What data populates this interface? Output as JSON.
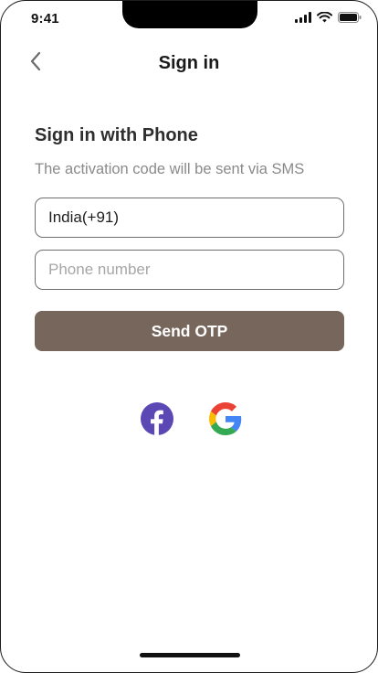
{
  "status_bar": {
    "time": "9:41",
    "icons": [
      "cellular-signal-icon",
      "wifi-icon",
      "battery-icon"
    ]
  },
  "header": {
    "back_icon": "chevron-left-icon",
    "title": "Sign in"
  },
  "form": {
    "heading": "Sign in with Phone",
    "subtitle": "The activation code will be sent via SMS",
    "country_value": "India(+91)",
    "phone_placeholder": "Phone number",
    "phone_value": "",
    "submit_label": "Send OTP"
  },
  "social_login": {
    "providers": [
      "facebook-icon",
      "google-icon"
    ]
  },
  "colors": {
    "primary_button": "#77665c",
    "facebook": "#5b48b5",
    "input_border": "#6f6f6f",
    "subtitle_text": "#8a8a8a"
  }
}
